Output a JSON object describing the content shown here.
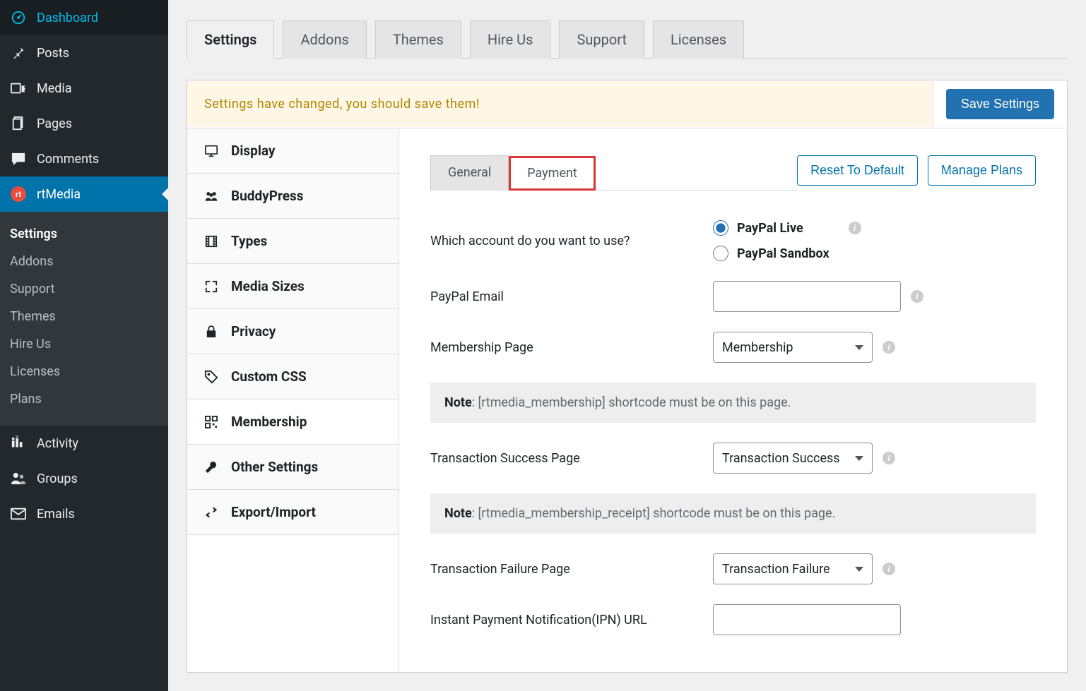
{
  "wp_sidebar": {
    "items": [
      {
        "label": "Dashboard",
        "icon": "dashboard"
      },
      {
        "label": "Posts",
        "icon": "pin"
      },
      {
        "label": "Media",
        "icon": "media"
      },
      {
        "label": "Pages",
        "icon": "pages"
      },
      {
        "label": "Comments",
        "icon": "comments"
      },
      {
        "label": "rtMedia",
        "icon": "rt",
        "active": true
      },
      {
        "label": "Activity",
        "icon": "activity"
      },
      {
        "label": "Groups",
        "icon": "groups"
      },
      {
        "label": "Emails",
        "icon": "emails"
      }
    ],
    "submenu": [
      {
        "label": "Settings",
        "active": true
      },
      {
        "label": "Addons"
      },
      {
        "label": "Support"
      },
      {
        "label": "Themes"
      },
      {
        "label": "Hire Us"
      },
      {
        "label": "Licenses"
      },
      {
        "label": "Plans"
      }
    ]
  },
  "top_tabs": [
    {
      "label": "Settings",
      "active": true
    },
    {
      "label": "Addons"
    },
    {
      "label": "Themes"
    },
    {
      "label": "Hire Us"
    },
    {
      "label": "Support"
    },
    {
      "label": "Licenses"
    }
  ],
  "notice_text": "Settings have changed, you should save them!",
  "save_button": "Save Settings",
  "settings_nav": [
    {
      "label": "Display",
      "icon": "display"
    },
    {
      "label": "BuddyPress",
      "icon": "group"
    },
    {
      "label": "Types",
      "icon": "film"
    },
    {
      "label": "Media Sizes",
      "icon": "expand"
    },
    {
      "label": "Privacy",
      "icon": "lock"
    },
    {
      "label": "Custom CSS",
      "icon": "tag"
    },
    {
      "label": "Membership",
      "icon": "qr",
      "active": true
    },
    {
      "label": "Other Settings",
      "icon": "wrench"
    },
    {
      "label": "Export/Import",
      "icon": "exchange"
    }
  ],
  "sub_tabs": [
    {
      "label": "General"
    },
    {
      "label": "Payment",
      "active": true,
      "highlighted": true
    }
  ],
  "actions": {
    "reset": "Reset To Default",
    "manage": "Manage Plans"
  },
  "fields": {
    "account_label": "Which account do you want to use?",
    "paypal_live": "PayPal Live",
    "paypal_sandbox": "PayPal Sandbox",
    "paypal_email_label": "PayPal Email",
    "membership_page_label": "Membership Page",
    "membership_page_value": "Membership",
    "note1_bold": "Note",
    "note1_text": ": [rtmedia_membership] shortcode must be on this page.",
    "trans_success_label": "Transaction Success Page",
    "trans_success_value": "Transaction Success",
    "note2_bold": "Note",
    "note2_text": ": [rtmedia_membership_receipt] shortcode must be on this page.",
    "trans_failure_label": "Transaction Failure Page",
    "trans_failure_value": "Transaction Failure",
    "ipn_label": "Instant Payment Notification(IPN) URL"
  }
}
